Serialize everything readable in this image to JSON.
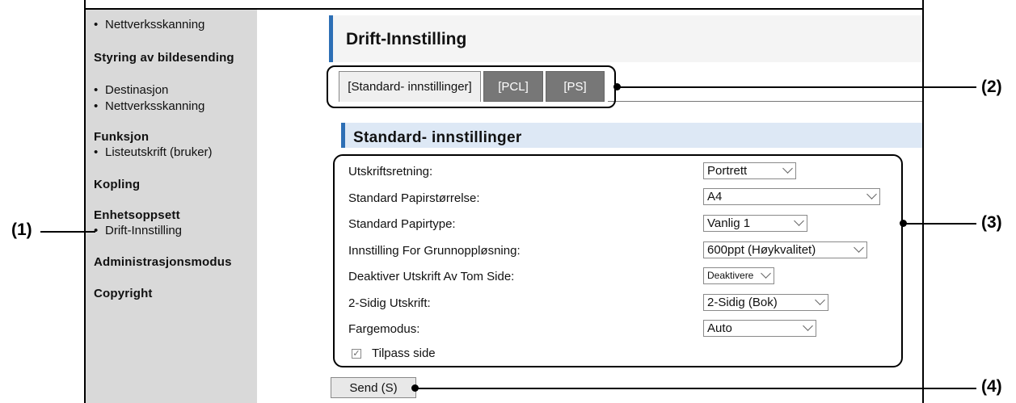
{
  "callouts": [
    "(1)",
    "(2)",
    "(3)",
    "(4)"
  ],
  "sidebar": {
    "items": [
      {
        "label": "Nettverksskanning",
        "type": "item"
      },
      {
        "label": "Styring av bildesending",
        "type": "heading"
      },
      {
        "label": "Destinasjon",
        "type": "item"
      },
      {
        "label": "Nettverksskanning",
        "type": "item"
      },
      {
        "label": "Funksjon",
        "type": "heading"
      },
      {
        "label": "Listeutskrift (bruker)",
        "type": "item"
      },
      {
        "label": "Kopling",
        "type": "heading"
      },
      {
        "label": "Enhetsoppsett",
        "type": "heading"
      },
      {
        "label": "Drift-Innstilling",
        "type": "item"
      },
      {
        "label": "Administrasjonsmodus",
        "type": "heading"
      },
      {
        "label": "Copyright",
        "type": "heading"
      }
    ]
  },
  "page": {
    "title": "Drift-Innstilling"
  },
  "tabs": [
    {
      "label": "[Standard- innstillinger]",
      "active": true
    },
    {
      "label": "[PCL]",
      "active": false
    },
    {
      "label": "[PS]",
      "active": false
    }
  ],
  "section": {
    "title": "Standard- innstillinger"
  },
  "form": {
    "fields": [
      {
        "label": "Utskriftsretning:",
        "value": "Portrett"
      },
      {
        "label": "Standard Papirstørrelse:",
        "value": "A4"
      },
      {
        "label": "Standard Papirtype:",
        "value": "Vanlig 1"
      },
      {
        "label": "Innstilling For Grunnoppløsning:",
        "value": "600ppt (Høykvalitet)"
      },
      {
        "label": "Deaktiver Utskrift Av Tom Side:",
        "value": "Deaktivere"
      },
      {
        "label": "2-Sidig Utskrift:",
        "value": "2-Sidig (Bok)"
      },
      {
        "label": "Fargemodus:",
        "value": "Auto"
      }
    ],
    "checkbox": {
      "label": "Tilpass side",
      "checked": true
    }
  },
  "send_label": "Send (S)",
  "colors": {
    "accent": "#2d6fb5",
    "sidebar_bg": "#d9d9d9",
    "section_bg": "#dde8f5",
    "tab_inactive": "#777777"
  }
}
